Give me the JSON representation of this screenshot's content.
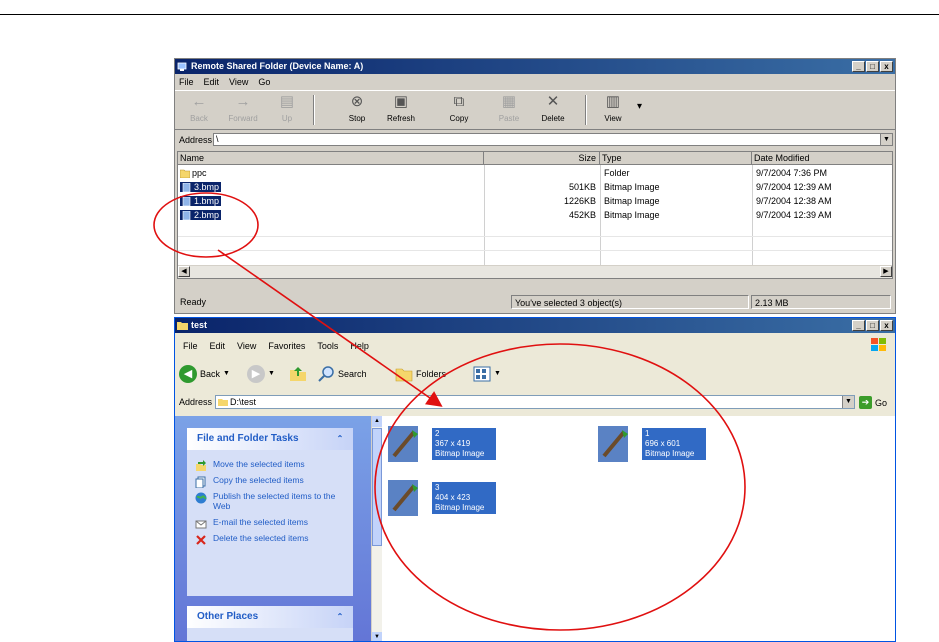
{
  "window1": {
    "title": "Remote Shared Folder (Device Name: A)",
    "menu": [
      "File",
      "Edit",
      "View",
      "Go"
    ],
    "toolbar": {
      "back": "Back",
      "forward": "Forward",
      "up": "Up",
      "stop": "Stop",
      "refresh": "Refresh",
      "copy": "Copy",
      "paste": "Paste",
      "delete": "Delete",
      "view": "View"
    },
    "address_label": "Address",
    "address_value": "\\",
    "columns": [
      "Name",
      "Size",
      "Type",
      "Date Modified"
    ],
    "rows": [
      {
        "name": "ppc",
        "size": "",
        "type": "Folder",
        "date": "9/7/2004 7:36 PM",
        "selected": false
      },
      {
        "name": "3.bmp",
        "size": "501KB",
        "type": "Bitmap Image",
        "date": "9/7/2004 12:39 AM",
        "selected": true
      },
      {
        "name": "1.bmp",
        "size": "1226KB",
        "type": "Bitmap Image",
        "date": "9/7/2004 12:38 AM",
        "selected": true
      },
      {
        "name": "2.bmp",
        "size": "452KB",
        "type": "Bitmap Image",
        "date": "9/7/2004 12:39 AM",
        "selected": true
      }
    ],
    "status": {
      "left": "Ready",
      "middle": "You've selected 3 object(s)",
      "right": "2.13 MB"
    }
  },
  "window2": {
    "title": "test",
    "menu": [
      "File",
      "Edit",
      "View",
      "Favorites",
      "Tools",
      "Help"
    ],
    "toolbar": {
      "back": "Back",
      "search": "Search",
      "folders": "Folders"
    },
    "address_label": "Address",
    "address_value": "D:\\test",
    "go_label": "Go",
    "tasks": {
      "header": "File and Folder Tasks",
      "items": [
        "Move the selected items",
        "Copy the selected items",
        "Publish the selected items to the Web",
        "E-mail the selected items",
        "Delete the selected items"
      ]
    },
    "other_places": "Other Places",
    "thumbnails": [
      {
        "name": "2",
        "dims": "367 x 419",
        "type": "Bitmap Image"
      },
      {
        "name": "1",
        "dims": "696 x 601",
        "type": "Bitmap Image"
      },
      {
        "name": "3",
        "dims": "404 x 423",
        "type": "Bitmap Image"
      }
    ]
  },
  "colors": {
    "classic_title": "#0a246a",
    "selection": "#316ac5",
    "task_pane": "#7ba2e7",
    "annotation": "#e01010"
  }
}
